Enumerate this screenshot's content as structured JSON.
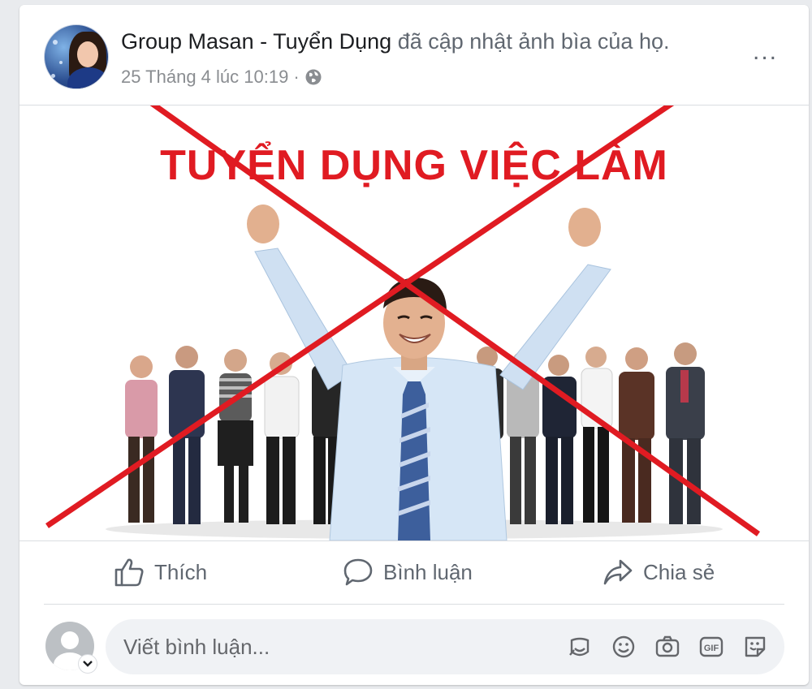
{
  "post": {
    "author_name": "Group Masan - Tuyển Dụng",
    "action_text": "đã cập nhật ảnh bìa của họ.",
    "timestamp": "25 Tháng 4 lúc 10:19",
    "separator": "·",
    "privacy_icon": "globe-icon",
    "more_icon": "more-options-icon",
    "more_label": "..."
  },
  "cover": {
    "headline": "TUYỂN DỤNG VIỆC LÀM",
    "overlay": "red-x-mark",
    "accent_color": "#e01b22"
  },
  "actions": {
    "like_label": "Thích",
    "comment_label": "Bình luận",
    "share_label": "Chia sẻ"
  },
  "composer": {
    "placeholder": "Viết bình luận...",
    "tools": [
      "sticker-icon",
      "emoji-icon",
      "camera-icon",
      "gif-icon",
      "avatar-sticker-icon"
    ],
    "gif_label": "GIF"
  }
}
